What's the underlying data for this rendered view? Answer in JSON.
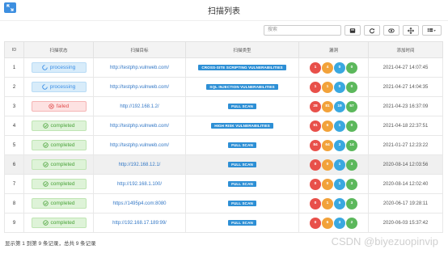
{
  "title": "扫描列表",
  "search": {
    "placeholder": "搜索"
  },
  "table": {
    "headers": [
      "ID",
      "扫描状态",
      "扫描目标",
      "扫描类型",
      "漏洞",
      "添加时间"
    ],
    "rows": [
      {
        "id": "1",
        "status": "processing",
        "target": "http://testphp.vulnweb.com/",
        "type": "CROSS-SITE SCRIPTING VULNERABILITIES",
        "vulns": [
          "1",
          "4",
          "0",
          "0"
        ],
        "time": "2021-04-27 14:07:45"
      },
      {
        "id": "2",
        "status": "processing",
        "target": "http://testphp.vulnweb.com/",
        "type": "SQL INJECTION VULNERABILITIES",
        "vulns": [
          "1",
          "1",
          "0",
          "0"
        ],
        "time": "2021-04-27 14:04:35"
      },
      {
        "id": "3",
        "status": "failed",
        "target": "http://192.168.1.2/",
        "type": "FULL SCAN",
        "vulns": [
          "28",
          "81",
          "19",
          "57"
        ],
        "time": "2021-04-23 16:37:09"
      },
      {
        "id": "4",
        "status": "completed",
        "target": "http://testphp.vulnweb.com/",
        "type": "HIGH RISK VULNERABILITIES",
        "vulns": [
          "91",
          "6",
          "1",
          "0"
        ],
        "time": "2021-04-18 22:37:51"
      },
      {
        "id": "5",
        "status": "completed",
        "target": "http://testphp.vulnweb.com/",
        "type": "FULL SCAN",
        "vulns": [
          "84",
          "64",
          "3",
          "14"
        ],
        "time": "2021-01-27 12:23:22"
      },
      {
        "id": "6",
        "status": "completed",
        "target": "http://192.168.12.1/",
        "type": "FULL SCAN",
        "vulns": [
          "0",
          "0",
          "1",
          "3"
        ],
        "time": "2020-08-14 12:03:56"
      },
      {
        "id": "7",
        "status": "completed",
        "target": "http://192.168.1.100/",
        "type": "FULL SCAN",
        "vulns": [
          "0",
          "0",
          "1",
          "3"
        ],
        "time": "2020-08-14 12:02:40"
      },
      {
        "id": "8",
        "status": "completed",
        "target": "https://1495p4.com:8080",
        "type": "FULL SCAN",
        "vulns": [
          "0",
          "1",
          "5",
          "3"
        ],
        "time": "2020-06-17 19:28:11"
      },
      {
        "id": "9",
        "status": "completed",
        "target": "http://192.168.17.189:99/",
        "type": "FULL SCAN",
        "vulns": [
          "0",
          "6",
          "3",
          "2"
        ],
        "time": "2020-06-03 15:37:42"
      }
    ]
  },
  "footer": "显示第 1 到第 9 条记录，总共 9 条记录",
  "watermark": "CSDN @biyezuopinvip",
  "colors": {
    "processing": "#3a8ee6",
    "failed": "#e24f4f",
    "completed": "#4aa33a",
    "accent": "#2d8fd5"
  },
  "icons": {
    "corner": "expand-icon",
    "toolbar": [
      "toggle-icon",
      "refresh-icon",
      "columns-icon",
      "fullscreen-icon",
      "export-icon"
    ]
  }
}
